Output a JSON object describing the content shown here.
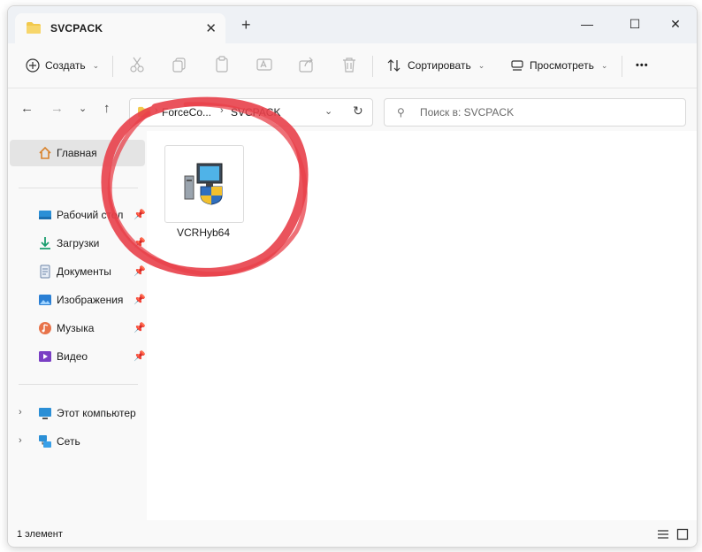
{
  "window": {
    "tab_title": "SVCPACK",
    "tab_close": "✕",
    "new_tab": "+",
    "minimize": "—",
    "maximize": "☐",
    "close": "✕"
  },
  "toolbar": {
    "create_label": "Создать",
    "sort_label": "Сортировать",
    "view_label": "Просмотреть",
    "more_label": "•••"
  },
  "address": {
    "crumbs": [
      "ForceCo...",
      "SVCPACK"
    ],
    "search_placeholder": "Поиск в: SVCPACK"
  },
  "sidebar": {
    "home": "Главная",
    "quick": [
      {
        "label": "Рабочий стол",
        "icon": "desktop-icon"
      },
      {
        "label": "Загрузки",
        "icon": "downloads-icon"
      },
      {
        "label": "Документы",
        "icon": "documents-icon"
      },
      {
        "label": "Изображения",
        "icon": "pictures-icon"
      },
      {
        "label": "Музыка",
        "icon": "music-icon"
      },
      {
        "label": "Видео",
        "icon": "video-icon"
      }
    ],
    "this_pc": "Этот компьютер",
    "network": "Сеть"
  },
  "files": [
    {
      "name": "VCRHyb64",
      "icon": "installer-icon"
    }
  ],
  "status": {
    "count": "1 элемент"
  },
  "colors": {
    "highlight_circle": "#e8404a",
    "folder": "#f2c94c",
    "accent": "#0067c0"
  }
}
